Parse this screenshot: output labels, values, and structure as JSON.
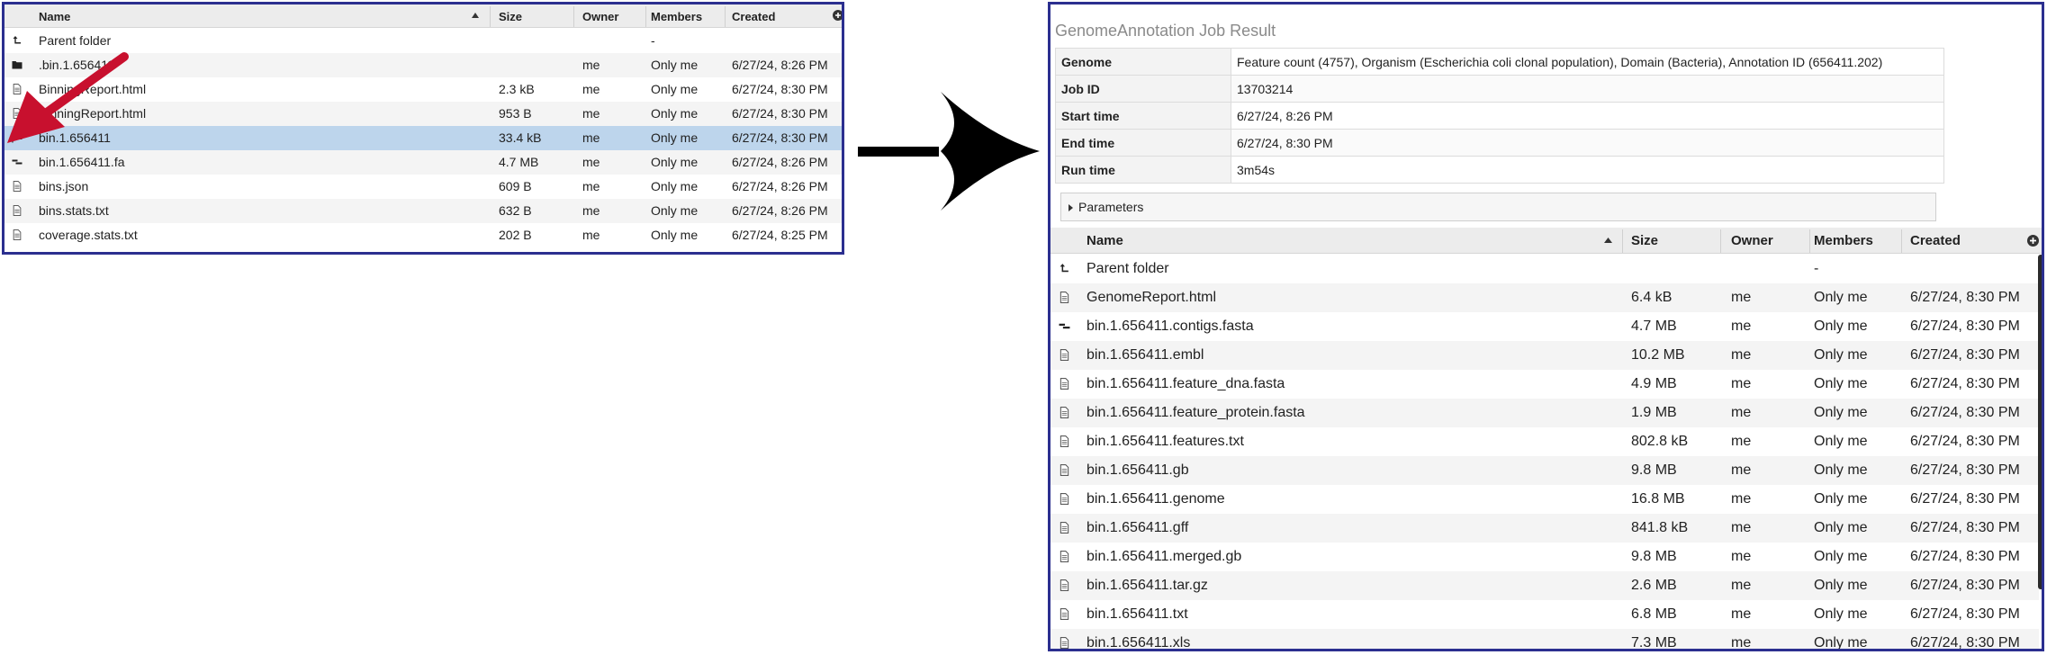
{
  "left_panel": {
    "columns": {
      "name": "Name",
      "size": "Size",
      "owner": "Owner",
      "members": "Members",
      "created": "Created"
    },
    "rows": [
      {
        "icon": "parent-folder-icon",
        "name": "Parent folder",
        "size": "",
        "owner": "",
        "members": "-",
        "created": ""
      },
      {
        "icon": "folder-icon",
        "name": ".bin.1.656411",
        "size": "",
        "owner": "me",
        "members": "Only me",
        "created": "6/27/24, 8:26 PM"
      },
      {
        "icon": "document-icon",
        "name": "BinningReport.html",
        "size": "2.3 kB",
        "owner": "me",
        "members": "Only me",
        "created": "6/27/24, 8:30 PM"
      },
      {
        "icon": "document-icon",
        "name": "BinningReport.html",
        "size": "953 B",
        "owner": "me",
        "members": "Only me",
        "created": "6/27/24, 8:30 PM"
      },
      {
        "icon": "genome-flag-icon",
        "name": "bin.1.656411",
        "size": "33.4 kB",
        "owner": "me",
        "members": "Only me",
        "created": "6/27/24, 8:30 PM"
      },
      {
        "icon": "contigs-icon",
        "name": "bin.1.656411.fa",
        "size": "4.7 MB",
        "owner": "me",
        "members": "Only me",
        "created": "6/27/24, 8:26 PM"
      },
      {
        "icon": "document-icon",
        "name": "bins.json",
        "size": "609 B",
        "owner": "me",
        "members": "Only me",
        "created": "6/27/24, 8:26 PM"
      },
      {
        "icon": "document-icon",
        "name": "bins.stats.txt",
        "size": "632 B",
        "owner": "me",
        "members": "Only me",
        "created": "6/27/24, 8:26 PM"
      },
      {
        "icon": "document-icon",
        "name": "coverage.stats.txt",
        "size": "202 B",
        "owner": "me",
        "members": "Only me",
        "created": "6/27/24, 8:25 PM"
      }
    ]
  },
  "right_panel": {
    "title": "GenomeAnnotation Job Result",
    "meta": [
      {
        "label": "Genome",
        "value": "Feature count (4757), Organism (Escherichia coli clonal population), Domain (Bacteria), Annotation ID (656411.202)"
      },
      {
        "label": "Job ID",
        "value": "13703214"
      },
      {
        "label": "Start time",
        "value": "6/27/24, 8:26 PM"
      },
      {
        "label": "End time",
        "value": "6/27/24, 8:30 PM"
      },
      {
        "label": "Run time",
        "value": "3m54s"
      }
    ],
    "parameters_label": "Parameters",
    "columns": {
      "name": "Name",
      "size": "Size",
      "owner": "Owner",
      "members": "Members",
      "created": "Created"
    },
    "rows": [
      {
        "icon": "parent-folder-icon",
        "name": "Parent folder",
        "size": "",
        "owner": "",
        "members": "-",
        "created": ""
      },
      {
        "icon": "document-icon",
        "name": "GenomeReport.html",
        "size": "6.4 kB",
        "owner": "me",
        "members": "Only me",
        "created": "6/27/24, 8:30 PM"
      },
      {
        "icon": "contigs-icon",
        "name": "bin.1.656411.contigs.fasta",
        "size": "4.7 MB",
        "owner": "me",
        "members": "Only me",
        "created": "6/27/24, 8:30 PM"
      },
      {
        "icon": "document-icon",
        "name": "bin.1.656411.embl",
        "size": "10.2 MB",
        "owner": "me",
        "members": "Only me",
        "created": "6/27/24, 8:30 PM"
      },
      {
        "icon": "document-icon",
        "name": "bin.1.656411.feature_dna.fasta",
        "size": "4.9 MB",
        "owner": "me",
        "members": "Only me",
        "created": "6/27/24, 8:30 PM"
      },
      {
        "icon": "document-icon",
        "name": "bin.1.656411.feature_protein.fasta",
        "size": "1.9 MB",
        "owner": "me",
        "members": "Only me",
        "created": "6/27/24, 8:30 PM"
      },
      {
        "icon": "document-icon",
        "name": "bin.1.656411.features.txt",
        "size": "802.8 kB",
        "owner": "me",
        "members": "Only me",
        "created": "6/27/24, 8:30 PM"
      },
      {
        "icon": "document-icon",
        "name": "bin.1.656411.gb",
        "size": "9.8 MB",
        "owner": "me",
        "members": "Only me",
        "created": "6/27/24, 8:30 PM"
      },
      {
        "icon": "document-icon",
        "name": "bin.1.656411.genome",
        "size": "16.8 MB",
        "owner": "me",
        "members": "Only me",
        "created": "6/27/24, 8:30 PM"
      },
      {
        "icon": "document-icon",
        "name": "bin.1.656411.gff",
        "size": "841.8 kB",
        "owner": "me",
        "members": "Only me",
        "created": "6/27/24, 8:30 PM"
      },
      {
        "icon": "document-icon",
        "name": "bin.1.656411.merged.gb",
        "size": "9.8 MB",
        "owner": "me",
        "members": "Only me",
        "created": "6/27/24, 8:30 PM"
      },
      {
        "icon": "document-icon",
        "name": "bin.1.656411.tar.gz",
        "size": "2.6 MB",
        "owner": "me",
        "members": "Only me",
        "created": "6/27/24, 8:30 PM"
      },
      {
        "icon": "document-icon",
        "name": "bin.1.656411.txt",
        "size": "6.8 MB",
        "owner": "me",
        "members": "Only me",
        "created": "6/27/24, 8:30 PM"
      },
      {
        "icon": "document-icon",
        "name": "bin.1.656411.xls",
        "size": "7.3 MB",
        "owner": "me",
        "members": "Only me",
        "created": "6/27/24, 8:30 PM"
      }
    ]
  },
  "selected_left_row": 4,
  "colors": {
    "panel_border": "#2b2f8f",
    "selected_row": "#bdd5ec",
    "annotation_arrow": "#c8102e",
    "flow_arrow": "#000000"
  }
}
